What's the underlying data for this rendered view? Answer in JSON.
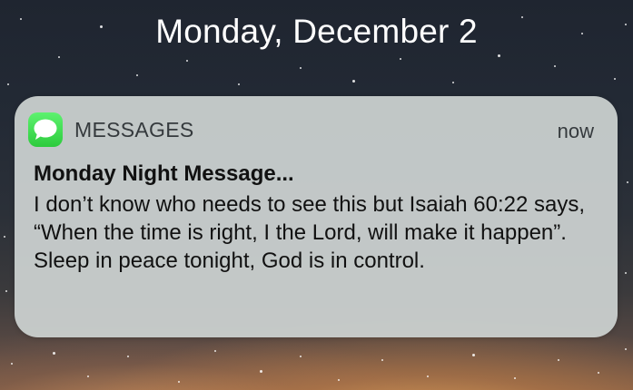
{
  "lock_screen": {
    "date": "Monday, December 2"
  },
  "notification": {
    "app_icon": "messages-icon",
    "app_name": "MESSAGES",
    "time": "now",
    "title": "Monday Night Message...",
    "body": "I don’t know who needs to see this but Isaiah 60:22 says, “When the time is right, I the Lord, will make it happen”. Sleep in peace tonight, God is in control.",
    "accent_color": "#34d449"
  }
}
